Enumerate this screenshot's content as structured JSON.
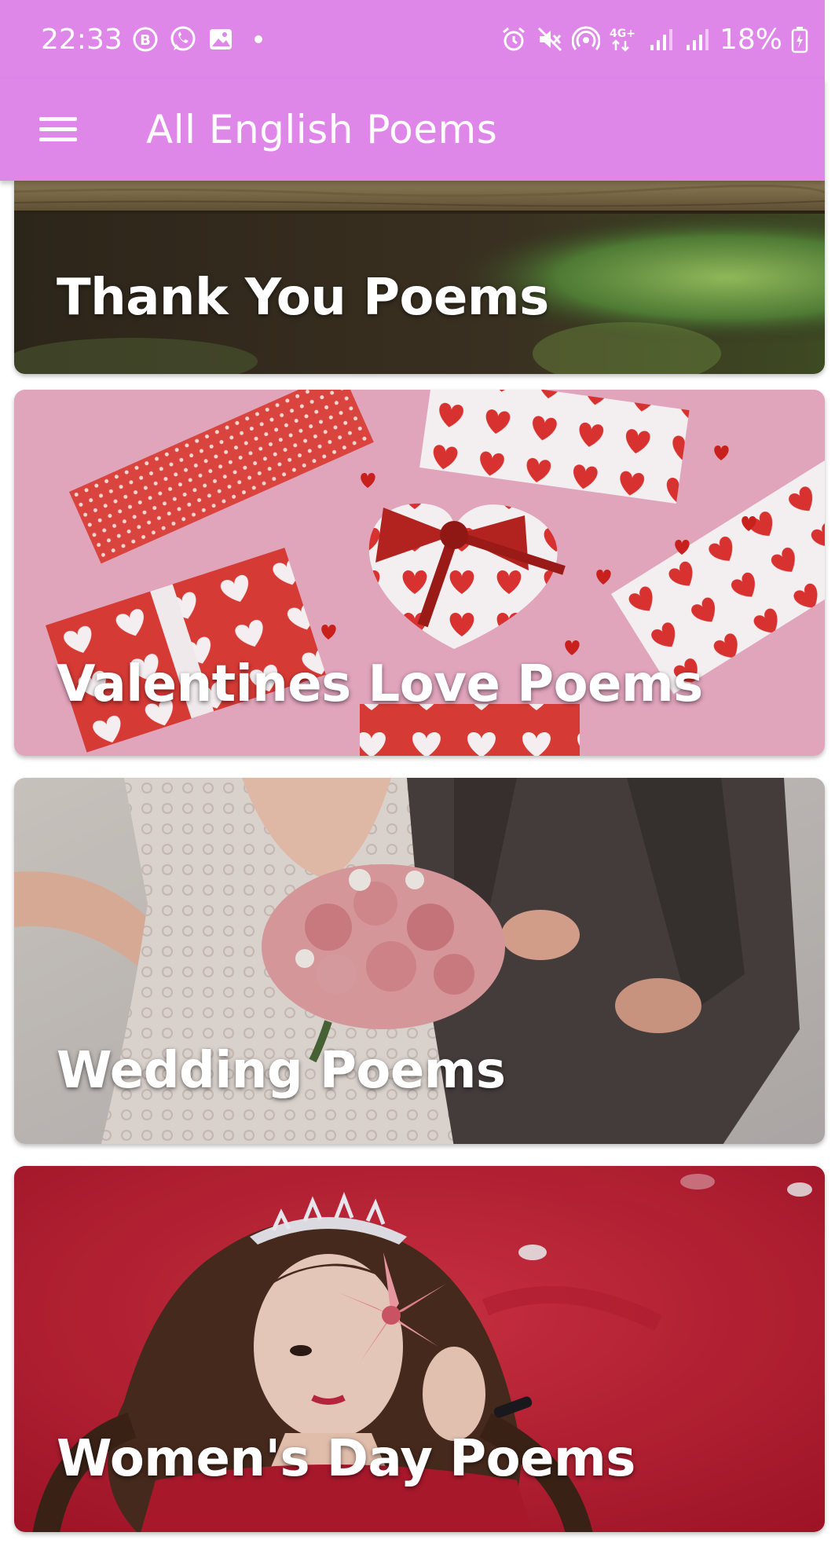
{
  "status_bar": {
    "time": "22:33",
    "battery": "18%",
    "network": "4G+",
    "left_icons": [
      "b-circle-icon",
      "whatsapp-icon",
      "gallery-icon",
      "dot-icon"
    ],
    "right_icons": [
      "alarm-icon",
      "mute-icon",
      "hotspot-icon",
      "network-icon",
      "signal-icon",
      "signal-icon",
      "battery-charging-icon"
    ]
  },
  "app_bar": {
    "title": "All English Poems",
    "background": "#df86e9"
  },
  "poems": [
    {
      "label": "Thank You Poems",
      "image": "wooden-frame-greenery"
    },
    {
      "label": "Valentines Love Poems",
      "image": "heart-gift-boxes"
    },
    {
      "label": "Wedding Poems",
      "image": "bride-and-groom"
    },
    {
      "label": "Women's Day Poems",
      "image": "woman-with-tiara"
    }
  ],
  "colors": {
    "accent": "#df86e9",
    "text_on_image": "#ffffff"
  }
}
